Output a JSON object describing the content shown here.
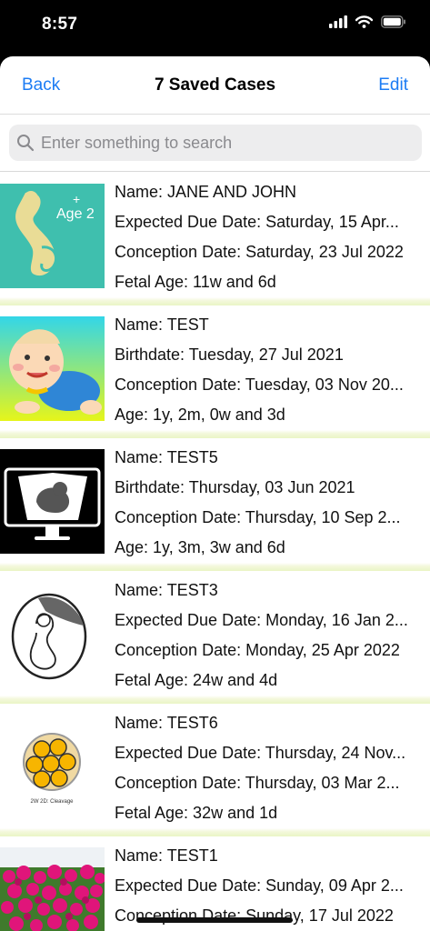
{
  "status_bar": {
    "time": "8:57"
  },
  "nav": {
    "back_label": "Back",
    "title": "7 Saved Cases",
    "edit_label": "Edit"
  },
  "search": {
    "placeholder": "Enter something to search"
  },
  "cases": [
    {
      "thumb": "pregnancy-age-icon",
      "line1": "Name: JANE AND JOHN",
      "line2": "Expected Due Date: Saturday, 15 Apr...",
      "line3": "Conception Date: Saturday, 23 Jul 2022",
      "line4": "Fetal Age: 11w and 6d"
    },
    {
      "thumb": "crawling-baby-icon",
      "line1": "Name: TEST",
      "line2": "Birthdate: Tuesday, 27 Jul 2021",
      "line3": "Conception Date: Tuesday, 03 Nov 20...",
      "line4": "Age: 1y, 2m, 0w and 3d"
    },
    {
      "thumb": "ultrasound-monitor-icon",
      "line1": "Name: TEST5",
      "line2": "Birthdate: Thursday, 03 Jun 2021",
      "line3": "Conception Date: Thursday, 10 Sep 2...",
      "line4": "Age: 1y, 3m, 3w and 6d"
    },
    {
      "thumb": "fetus-in-uterus-icon",
      "line1": "Name: TEST3",
      "line2": "Expected Due Date: Monday, 16 Jan 2...",
      "line3": "Conception Date: Monday, 25 Apr 2022",
      "line4": "Fetal Age: 24w and 4d"
    },
    {
      "thumb": "embryo-cleavage-icon",
      "thumb_caption": "2W 2D: Cleavage",
      "line1": "Name: TEST6",
      "line2": "Expected Due Date: Thursday, 24 Nov...",
      "line3": "Conception Date: Thursday, 03 Mar 2...",
      "line4": "Fetal Age: 32w and 1d"
    },
    {
      "thumb": "flower-field-photo",
      "line1": "Name: TEST1",
      "line2": "Expected Due Date: Sunday, 09 Apr 2...",
      "line3": "Conception Date: Sunday, 17 Jul 2022",
      "line4": ""
    }
  ]
}
